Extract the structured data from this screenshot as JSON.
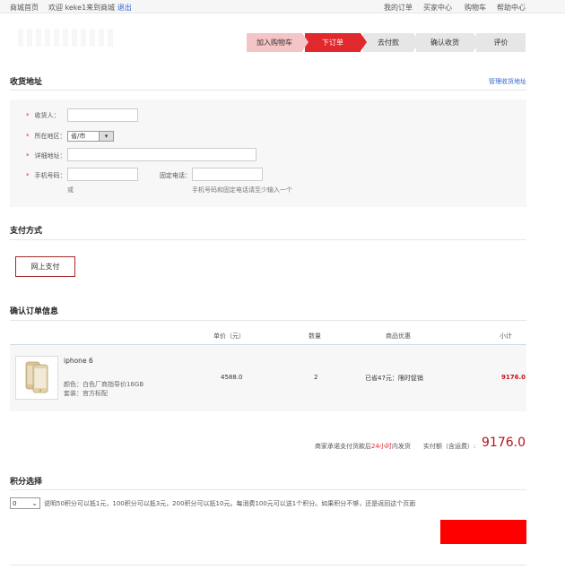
{
  "topbar": {
    "home": "商城首页",
    "welcome_prefix": "欢迎 keke1来到商城",
    "logout": "退出",
    "links": [
      "我的订单",
      "买家中心",
      "购物车",
      "帮助中心"
    ]
  },
  "steps": [
    "加入购物车",
    "下订单",
    "去付款",
    "确认收货",
    "评价"
  ],
  "address": {
    "title": "收货地址",
    "manage_link": "管理收货地址",
    "labels": {
      "receiver": "收货人：",
      "region": "所在地区：",
      "detail": "详细地址：",
      "mobile": "手机号码：",
      "phone": "固定电话："
    },
    "region_value": "省/市",
    "or_text": "或",
    "phone_hint": "手机号码和固定电话请至少输入一个"
  },
  "payment": {
    "title": "支付方式",
    "option": "网上支付"
  },
  "order": {
    "title": "确认订单信息",
    "headers": {
      "price": "单价（元）",
      "qty": "数量",
      "discount": "商品优惠",
      "subtotal": "小计"
    },
    "item": {
      "name": "iphone 6",
      "color": "颜色：白色厂商指导价16GB",
      "package": "套装：官方标配",
      "price": "4588.0",
      "qty": "2",
      "discount": "已省47元：限时促销",
      "subtotal": "9176.0"
    },
    "promise_prefix": "商家承诺支付货款后",
    "promise_highlight": "24小时",
    "promise_suffix": "内发货",
    "total_label": "实付额（含运费）:",
    "total_amount": "9176.0"
  },
  "points": {
    "title": "积分选择",
    "selected": "0",
    "note": "说明50积分可以抵1元，100积分可以抵3元，200积分可以抵10元。每消费100元可以送1个积分。如果积分不够，还是返回这个页面"
  },
  "colors": {
    "accent": "#e0282d",
    "step_light": "#f5c4c6",
    "total": "#b3131a",
    "submit": "#ff0000",
    "link": "#3366cc"
  }
}
